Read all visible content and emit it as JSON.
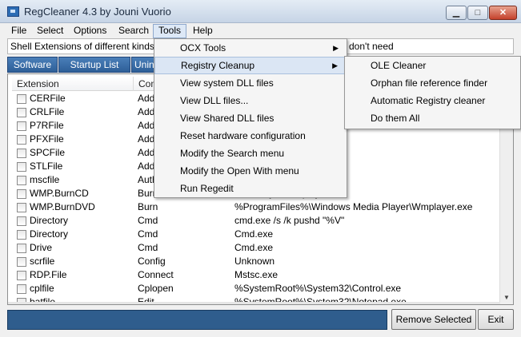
{
  "window": {
    "title": "RegCleaner 4.3 by Jouni Vuorio",
    "min_glyph": "▁",
    "max_glyph": "□",
    "close_glyph": "✕"
  },
  "menubar": {
    "items": [
      "File",
      "Select",
      "Options",
      "Search",
      "Tools",
      "Help"
    ],
    "active": "Tools"
  },
  "info": {
    "text": "Shell Extensions of different kinds of f",
    "tail": "don't need"
  },
  "tabs": [
    "Software",
    "Startup List",
    "Uninsta"
  ],
  "list": {
    "columns": [
      "Extension",
      "Com"
    ],
    "rows": [
      {
        "ext": "CERFile",
        "cmd": "Add",
        "path": ""
      },
      {
        "ext": "CRLFile",
        "cmd": "Add",
        "path": ""
      },
      {
        "ext": "P7RFile",
        "cmd": "Add",
        "path": ""
      },
      {
        "ext": "PFXFile",
        "cmd": "Add",
        "path": "ndll32.exe"
      },
      {
        "ext": "SPCFile",
        "cmd": "Add",
        "path": "ndll32.exe"
      },
      {
        "ext": "STLFile",
        "cmd": "Add",
        "path": "ndll32.exe"
      },
      {
        "ext": "mscfile",
        "cmd": "Auth",
        "path": "sc.exe"
      },
      {
        "ext": "WMP.BurnCD",
        "cmd": "Burn",
        "path": "edia Player\\Wmplayer.exe"
      },
      {
        "ext": "WMP.BurnDVD",
        "cmd": "Burn",
        "path": "%ProgramFiles%\\Windows Media Player\\Wmplayer.exe"
      },
      {
        "ext": "Directory",
        "cmd": "Cmd",
        "path": "cmd.exe /s /k pushd \"%V\""
      },
      {
        "ext": "Directory",
        "cmd": "Cmd",
        "path": "Cmd.exe"
      },
      {
        "ext": "Drive",
        "cmd": "Cmd",
        "path": "Cmd.exe"
      },
      {
        "ext": "scrfile",
        "cmd": "Config",
        "path": "Unknown"
      },
      {
        "ext": "RDP.File",
        "cmd": "Connect",
        "path": "Mstsc.exe"
      },
      {
        "ext": "cplfile",
        "cmd": "Cplopen",
        "path": "%SystemRoot%\\System32\\Control.exe"
      },
      {
        "ext": "batfile",
        "cmd": "Edit",
        "path": "%SystemRoot%\\System32\\Notepad.exe"
      }
    ]
  },
  "buttons": {
    "remove": "Remove Selected",
    "exit": "Exit"
  },
  "tools_menu": {
    "items": [
      {
        "label": "OCX Tools",
        "submenu": true
      },
      {
        "label": "Registry Cleanup",
        "submenu": true
      },
      {
        "label": "View system DLL files",
        "submenu": false
      },
      {
        "label": "View DLL files...",
        "submenu": false
      },
      {
        "label": "View Shared DLL files",
        "submenu": false
      },
      {
        "label": "Reset hardware configuration",
        "submenu": false
      },
      {
        "label": "Modify the Search menu",
        "submenu": false
      },
      {
        "label": "Modify the Open With menu",
        "submenu": false
      },
      {
        "label": "Run Regedit",
        "submenu": false
      }
    ],
    "highlighted": "Registry Cleanup"
  },
  "cleanup_submenu": {
    "items": [
      "OLE Cleaner",
      "Orphan file reference finder",
      "Automatic Registry cleaner",
      "Do them All"
    ]
  },
  "icons": {
    "app": "regcleaner-app-icon",
    "submenu_arrow": "▶",
    "scroll_up": "▲",
    "scroll_down": "▼"
  },
  "colors": {
    "progress": "#2f5d8d",
    "tab": "#3a6ea8",
    "menu_highlight": "#dbe6f4"
  }
}
